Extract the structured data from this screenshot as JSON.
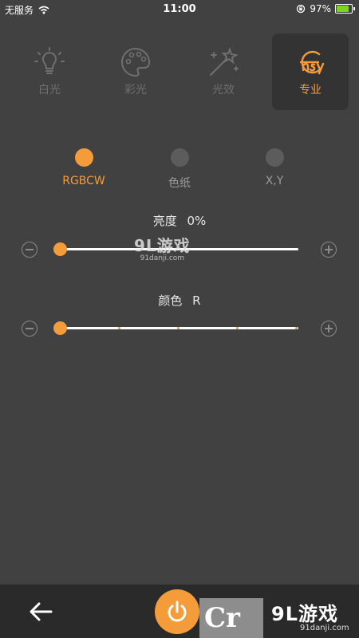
{
  "status": {
    "carrier": "无服务",
    "time": "11:00",
    "battery": "97%",
    "battery_level": 0.97
  },
  "modes": [
    {
      "label": "白光",
      "icon": "bulb-icon"
    },
    {
      "label": "彩光",
      "icon": "palette-icon"
    },
    {
      "label": "光效",
      "icon": "magic-wand-icon"
    },
    {
      "label": "专业",
      "icon": "pro-logo-icon",
      "active": true
    }
  ],
  "color_modes": [
    {
      "label": "RGBCW",
      "active": true
    },
    {
      "label": "色纸"
    },
    {
      "label": "X,Y"
    }
  ],
  "brightness": {
    "label": "亮度",
    "value": "0%",
    "level": 0
  },
  "color": {
    "label": "颜色",
    "value": "R",
    "level": 0
  },
  "watermark": {
    "main": "9L游戏",
    "sub": "91danji.com"
  },
  "bottom": {
    "brand_text": "Cr",
    "logo_main": "9L游戏",
    "logo_sub": "91danji.com"
  },
  "colors": {
    "accent": "#f49c3a",
    "background": "#414141",
    "bottom_bar": "#2a2a2a"
  }
}
